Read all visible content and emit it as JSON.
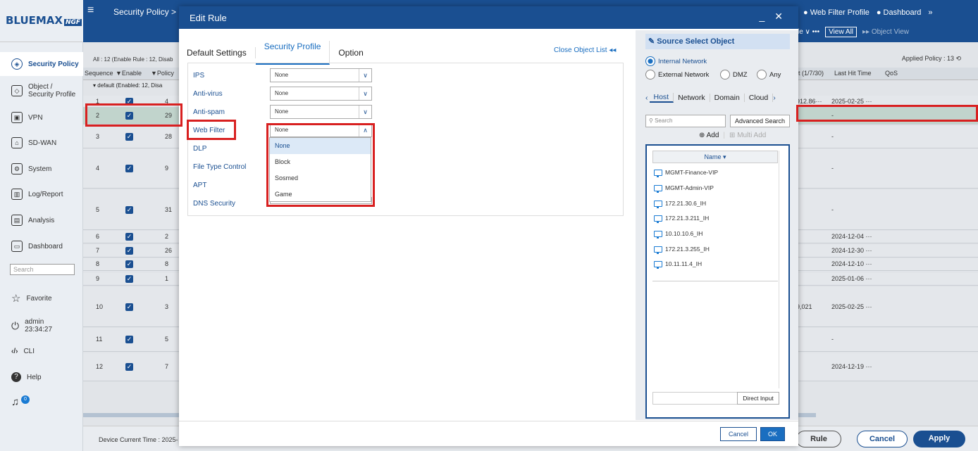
{
  "app": {
    "logo": "BLUEMAX",
    "logo_suffix": "NGF",
    "breadcrumb": "Security Policy >",
    "top_tabs": [
      "● Web Filter Profile",
      "● Dashboard",
      "»"
    ],
    "sub_actions": {
      "more": "le ∨  •••",
      "view_all": "View All",
      "object_view": "▸▸ Object View"
    }
  },
  "sidebar": {
    "items": [
      {
        "label": "Security Policy",
        "icon": "shield-icon",
        "active": true
      },
      {
        "label": "Object / Security Profile",
        "icon": "object-icon"
      },
      {
        "label": "VPN",
        "icon": "lock-icon"
      },
      {
        "label": "SD-WAN",
        "icon": "home-network-icon"
      },
      {
        "label": "System",
        "icon": "gear-icon"
      },
      {
        "label": "Log/Report",
        "icon": "chart-icon"
      },
      {
        "label": "Analysis",
        "icon": "analysis-icon"
      },
      {
        "label": "Dashboard",
        "icon": "dashboard-icon"
      }
    ],
    "search_placeholder": "Search",
    "bottom": [
      {
        "label": "Favorite",
        "icon": "star-icon"
      },
      {
        "label": "admin",
        "sub": "23:34:27",
        "icon": "power-icon"
      },
      {
        "label": "CLI",
        "icon": "code-icon"
      },
      {
        "label": "Help",
        "icon": "help-icon"
      }
    ],
    "notification_count": "0"
  },
  "table": {
    "all_info": "All : 12 (Enable Rule : 12, Disab",
    "applied_policy": "Applied Policy : 13",
    "headers": {
      "seq": "Sequence",
      "enable": "Enable",
      "policy": "Policy",
      "hit": "t (1/7/30)",
      "last_hit": "Last Hit Time",
      "qos": "QoS"
    },
    "group": "default (Enabled: 12, Disa",
    "rows": [
      {
        "seq": "1",
        "policy": "4",
        "hit": "912.86···",
        "last": "2025-02-25 ···"
      },
      {
        "seq": "2",
        "policy": "29",
        "hit": "",
        "last": "-"
      },
      {
        "seq": "3",
        "policy": "28",
        "hit": "",
        "last": "-"
      },
      {
        "seq": "4",
        "policy": "9",
        "hit": "",
        "last": "-"
      },
      {
        "seq": "5",
        "policy": "31",
        "hit": "",
        "last": "-"
      },
      {
        "seq": "6",
        "policy": "2",
        "hit": "",
        "last": "2024-12-04 ···"
      },
      {
        "seq": "7",
        "policy": "26",
        "hit": "",
        "last": "2024-12-30 ···"
      },
      {
        "seq": "8",
        "policy": "8",
        "hit": "",
        "last": "2024-12-10 ···"
      },
      {
        "seq": "9",
        "policy": "1",
        "hit": "",
        "last": "2025-01-06 ···"
      },
      {
        "seq": "10",
        "policy": "3",
        "hit": "9,021",
        "last": "2025-02-25 ···"
      },
      {
        "seq": "11",
        "policy": "5",
        "hit": "",
        "last": "-"
      },
      {
        "seq": "12",
        "policy": "7",
        "hit": "",
        "last": "2024-12-19 ···"
      }
    ]
  },
  "footer": {
    "device_time": "Device Current Time : 2025-",
    "rule_btn": "Rule",
    "cancel": "Cancel",
    "apply": "Apply"
  },
  "modal": {
    "title": "Edit Rule",
    "minimize": "_",
    "close": "✕",
    "tabs": [
      "Default Settings",
      "Security Profile",
      "Option"
    ],
    "active_tab": "Security Profile",
    "close_object_list": "Close Object List ◂◂",
    "fields": [
      {
        "label": "IPS",
        "value": "None"
      },
      {
        "label": "Anti-virus",
        "value": "None"
      },
      {
        "label": "Anti-spam",
        "value": "None"
      },
      {
        "label": "Web Filter",
        "value": "None"
      },
      {
        "label": "DLP",
        "value": ""
      },
      {
        "label": "File Type Control",
        "value": ""
      },
      {
        "label": "APT",
        "value": ""
      },
      {
        "label": "DNS Security",
        "value": ""
      }
    ],
    "dropdown_options": [
      "None",
      "Block",
      "Sosmed",
      "Game"
    ],
    "cancel": "Cancel",
    "ok": "OK"
  },
  "object_pane": {
    "title": "Source Select Object",
    "radios": [
      "Internal Network",
      "External Network",
      "DMZ",
      "Any"
    ],
    "selected_radio": "Internal Network",
    "tabs": [
      "Host",
      "Network",
      "Domain",
      "Cloud"
    ],
    "active_tab": "Host",
    "search_placeholder": "Search",
    "advanced_search": "Advanced Search",
    "add": "Add",
    "multi_add": "Multi Add",
    "column": "Name ▾",
    "items": [
      "MGMT-Finance-VIP",
      "MGMT-Admin-VIP",
      "172.21.30.6_IH",
      "172.21.3.211_IH",
      "10.10.10.6_IH",
      "172.21.3.255_IH",
      "10.11.11.4_IH"
    ],
    "direct_input": "Direct Input"
  }
}
